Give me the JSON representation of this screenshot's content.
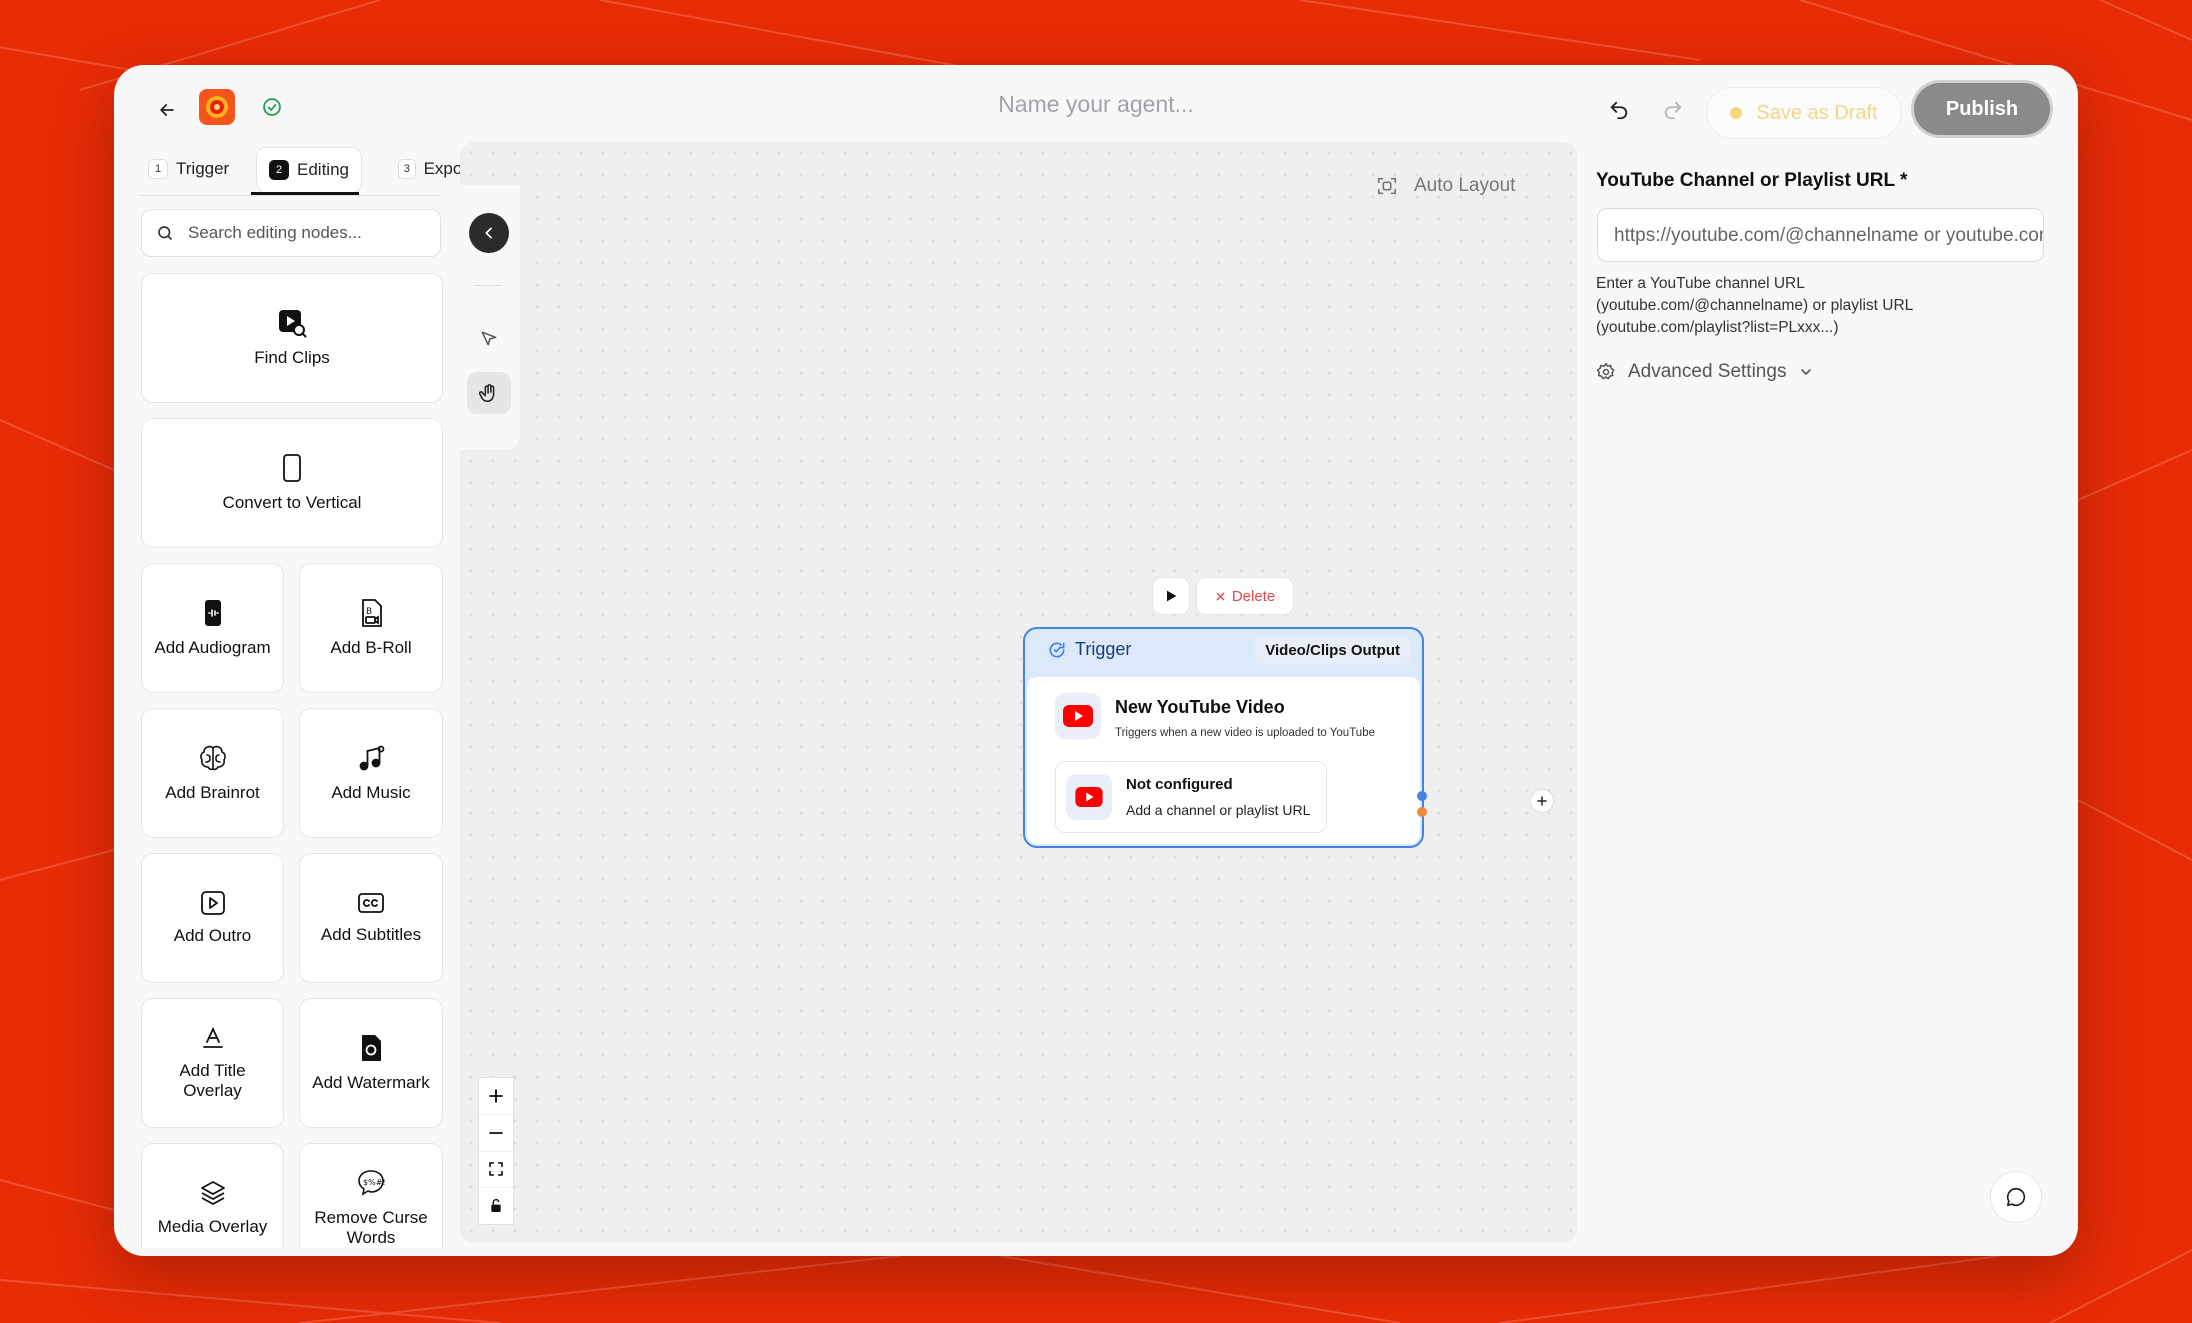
{
  "header": {
    "back_icon": "arrow-left-icon",
    "app_logo_icon": "app-logo-icon",
    "status_icon": "check-circle-icon",
    "agent_name_placeholder": "Name your agent...",
    "undo_icon": "undo-icon",
    "redo_icon": "redo-icon",
    "save_draft_label": "Save as Draft",
    "publish_label": "Publish"
  },
  "tabs": [
    {
      "num": "1",
      "label": "Trigger"
    },
    {
      "num": "2",
      "label": "Editing",
      "active": true
    },
    {
      "num": "3",
      "label": "Expor"
    }
  ],
  "search": {
    "placeholder": "Search editing nodes..."
  },
  "nodes": [
    {
      "label": "Find Clips",
      "icon": "video-search-icon"
    },
    {
      "label": "Convert to Vertical",
      "icon": "phone-icon"
    },
    {
      "label": "Add Audiogram",
      "icon": "audiogram-icon"
    },
    {
      "label": "Add B-Roll",
      "icon": "broll-icon"
    },
    {
      "label": "Add Brainrot",
      "icon": "brain-icon"
    },
    {
      "label": "Add Music",
      "icon": "music-icon"
    },
    {
      "label": "Add Outro",
      "icon": "play-square-icon"
    },
    {
      "label": "Add Subtitles",
      "icon": "cc-icon"
    },
    {
      "label": "Add Title Overlay",
      "icon": "text-underline-icon"
    },
    {
      "label": "Add Watermark",
      "icon": "file-watermark-icon"
    },
    {
      "label": "Media Overlay",
      "icon": "layers-icon"
    },
    {
      "label": "Remove Curse Words",
      "icon": "curse-bubble-icon"
    }
  ],
  "canvas": {
    "auto_layout_label": "Auto Layout",
    "node": {
      "delete_label": "Delete",
      "header_label": "Trigger",
      "output_label": "Video/Clips Output",
      "title": "New YouTube Video",
      "subtitle": "Triggers when a new video is uploaded to YouTube",
      "config_title": "Not configured",
      "config_subtitle": "Add a channel or playlist URL"
    }
  },
  "panel": {
    "field_label": "YouTube Channel or Playlist URL *",
    "field_placeholder": "https://youtube.com/@channelname or youtube.com/playlist?list=...",
    "help_text": "Enter a YouTube channel URL (youtube.com/@channelname) or playlist URL (youtube.com/playlist?list=PLxxx...)",
    "advanced_label": "Advanced Settings"
  },
  "colors": {
    "background": "#e82c06",
    "accent_blue": "#3f82e8",
    "delete_red": "#e5484d",
    "youtube_red": "#ff0000",
    "draft_yellow": "#f7d77e"
  }
}
